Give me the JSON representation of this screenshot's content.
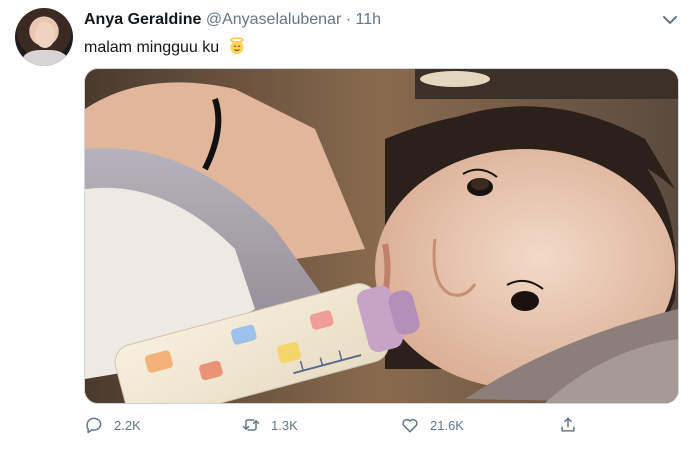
{
  "tweet": {
    "author_name": "Anya Geraldine",
    "author_handle": "@Anyaselalubenar",
    "separator": "·",
    "time": "11h",
    "text": "malam mingguu ku",
    "emoji": "angel-face-emoji",
    "media_alt": "selfie photo of woman lying in bed with baby bottle"
  },
  "actions": {
    "reply_count": "2.2K",
    "retweet_count": "1.3K",
    "like_count": "21.6K"
  },
  "icons": {
    "reply": "speech-bubble-icon",
    "retweet": "retweet-arrows-icon",
    "like": "heart-icon",
    "share": "share-upload-icon",
    "more": "chevron-down-icon"
  },
  "colors": {
    "text_primary": "#14171a",
    "text_secondary": "#657786",
    "border": "#ccd6dd"
  }
}
